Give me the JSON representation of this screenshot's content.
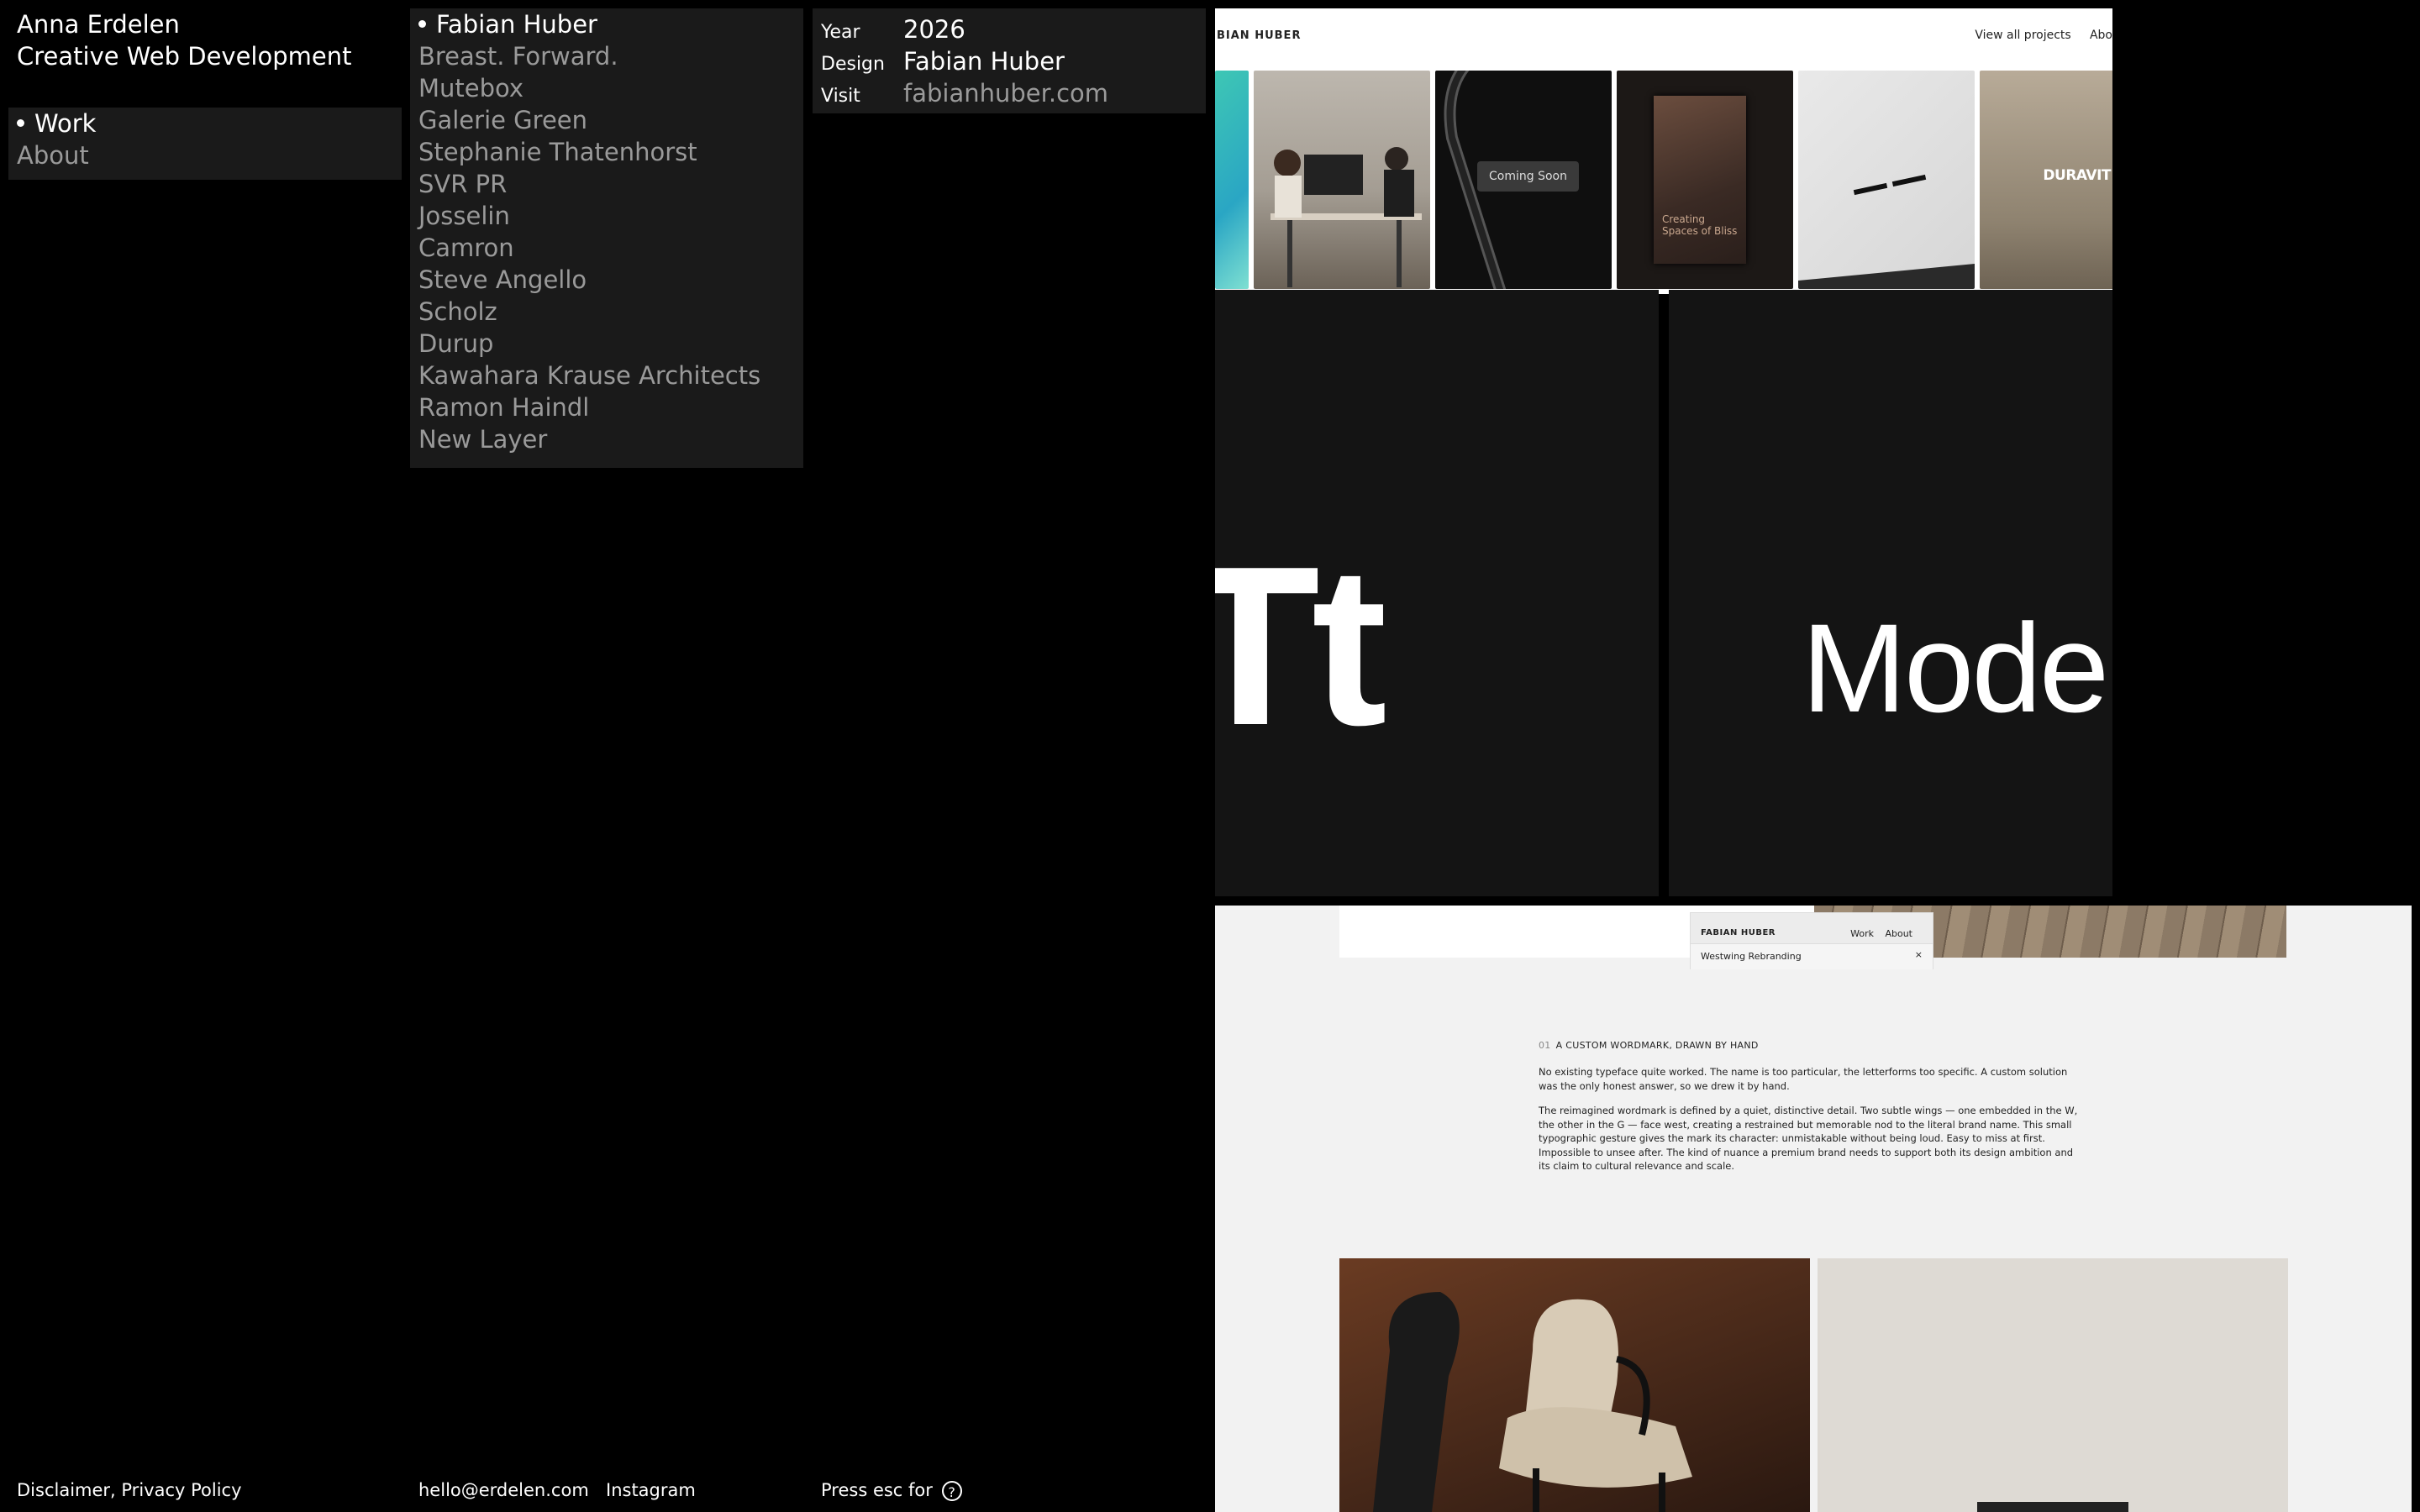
{
  "brand": {
    "name": "Anna Erdelen",
    "tagline": "Creative Web Development"
  },
  "nav": {
    "items": [
      {
        "label": "Work",
        "active": true
      },
      {
        "label": "About",
        "active": false
      }
    ]
  },
  "projects": [
    {
      "label": "Fabian Huber",
      "active": true
    },
    {
      "label": "Breast. Forward."
    },
    {
      "label": "Mutebox"
    },
    {
      "label": "Galerie Green"
    },
    {
      "label": "Stephanie Thatenhorst"
    },
    {
      "label": "SVR PR"
    },
    {
      "label": "Josselin"
    },
    {
      "label": "Camron"
    },
    {
      "label": "Steve Angello"
    },
    {
      "label": "Scholz"
    },
    {
      "label": "Durup"
    },
    {
      "label": "Kawahara Krause Architects"
    },
    {
      "label": "Ramon Haindl"
    },
    {
      "label": "New Layer"
    }
  ],
  "info": {
    "year_label": "Year",
    "year": "2026",
    "design_label": "Design",
    "design": "Fabian Huber",
    "visit_label": "Visit",
    "visit": "fabianhuber.com"
  },
  "footer": {
    "legal": "Disclaimer, Privacy Policy",
    "email": "hello@erdelen.com",
    "instagram": "Instagram",
    "esc_hint": "Press esc for",
    "help_glyph": "?"
  },
  "preview1": {
    "logo": "BIAN HUBER",
    "nav_projects": "View all projects",
    "nav_about": "Abo",
    "coming_soon": "Coming Soon",
    "duravit": "DURAVIT",
    "book_text": "Creating Spaces of Bliss",
    "big_left": "Tt",
    "big_right": "Mode"
  },
  "preview2": {
    "mini_logo": "FABIAN HUBER",
    "mini_work": "Work",
    "mini_about": "About",
    "mini_item": "Westwing Rebranding",
    "mini_close": "×",
    "section_num": "01",
    "section_title": "A CUSTOM WORDMARK, DRAWN BY HAND",
    "para1": "No existing typeface quite worked. The name is too particular, the letterforms too specific. A custom solution was the only honest answer, so we drew it by hand.",
    "para2": "The reimagined wordmark is defined by a quiet, distinctive detail. Two subtle wings — one embedded in the W, the other in the G — face west, creating a restrained but memorable nod to the literal brand name. This small typographic gesture gives the mark its character: unmistakable without being loud. Easy to miss at first. Impossible to unsee after. The kind of nuance a premium brand needs to support both its design ambition and its claim to cultural relevance and scale."
  },
  "colors": {
    "bg": "#000000",
    "panel": "#1a1a1a",
    "muted": "#9a9a9a",
    "text": "#ffffff"
  }
}
